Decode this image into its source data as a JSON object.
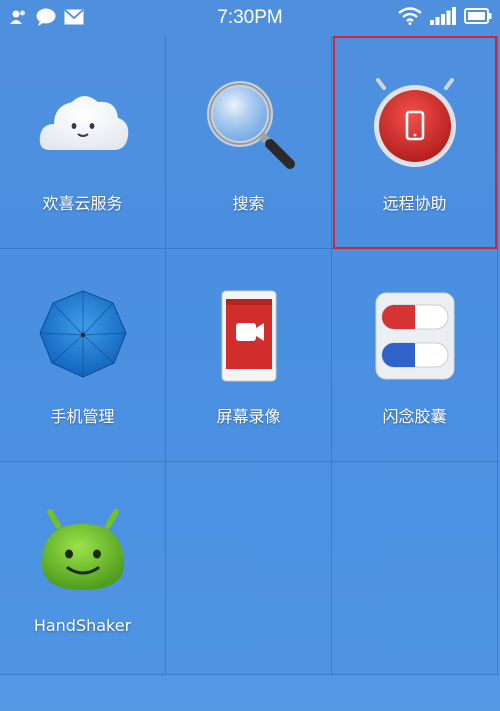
{
  "status_bar": {
    "time": "7:30PM",
    "icons_left": [
      "contacts-icon",
      "chat-bubble-icon",
      "mail-icon"
    ],
    "icons_right": [
      "wifi-icon",
      "signal-icon",
      "battery-icon"
    ]
  },
  "apps": [
    {
      "label": "欢喜云服务",
      "icon": "cloud-icon"
    },
    {
      "label": "搜索",
      "icon": "magnifier-icon"
    },
    {
      "label": "远程协助",
      "icon": "remote-assist-icon"
    },
    {
      "label": "手机管理",
      "icon": "umbrella-icon"
    },
    {
      "label": "屏幕录像",
      "icon": "screen-record-icon"
    },
    {
      "label": "闪念胶囊",
      "icon": "capsule-icon"
    },
    {
      "label": "HandShaker",
      "icon": "android-icon"
    }
  ],
  "colors": {
    "highlight_border": "#d2253a",
    "background": "#4a8fe0"
  }
}
